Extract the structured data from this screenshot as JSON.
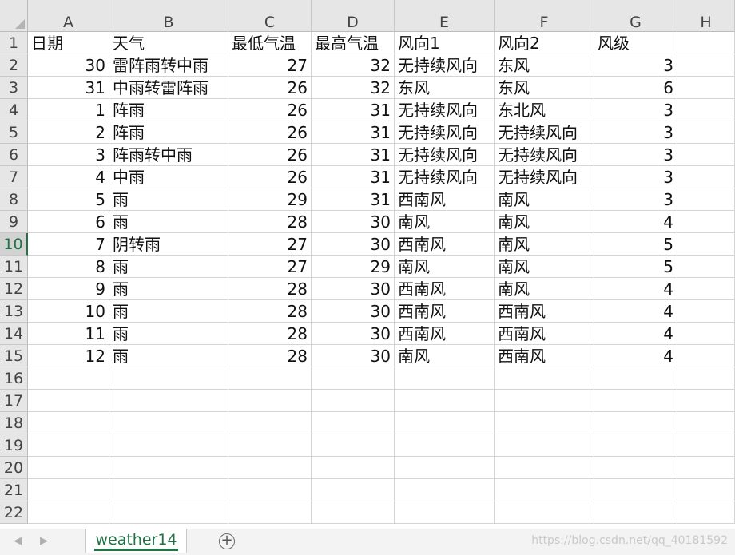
{
  "columns": [
    "A",
    "B",
    "C",
    "D",
    "E",
    "F",
    "G",
    "H"
  ],
  "row_numbers": [
    "1",
    "2",
    "3",
    "4",
    "5",
    "6",
    "7",
    "8",
    "9",
    "10",
    "11",
    "12",
    "13",
    "14",
    "15",
    "16",
    "17",
    "18",
    "19",
    "20",
    "21",
    "22"
  ],
  "active_row": "10",
  "header_row": [
    "日期",
    "天气",
    "最低气温",
    "最高气温",
    "风向1",
    "风向2",
    "风级"
  ],
  "rows": [
    [
      "30",
      "雷阵雨转中雨",
      "27",
      "32",
      "无持续风向",
      "东风",
      "3"
    ],
    [
      "31",
      "中雨转雷阵雨",
      "26",
      "32",
      "东风",
      "东风",
      "6"
    ],
    [
      "1",
      "阵雨",
      "26",
      "31",
      "无持续风向",
      "东北风",
      "3"
    ],
    [
      "2",
      "阵雨",
      "26",
      "31",
      "无持续风向",
      "无持续风向",
      "3"
    ],
    [
      "3",
      "阵雨转中雨",
      "26",
      "31",
      "无持续风向",
      "无持续风向",
      "3"
    ],
    [
      "4",
      "中雨",
      "26",
      "31",
      "无持续风向",
      "无持续风向",
      "3"
    ],
    [
      "5",
      "雨",
      "29",
      "31",
      "西南风",
      "南风",
      "3"
    ],
    [
      "6",
      "雨",
      "28",
      "30",
      "南风",
      "南风",
      "4"
    ],
    [
      "7",
      "阴转雨",
      "27",
      "30",
      "西南风",
      "南风",
      "5"
    ],
    [
      "8",
      "雨",
      "27",
      "29",
      "南风",
      "南风",
      "5"
    ],
    [
      "9",
      "雨",
      "28",
      "30",
      "西南风",
      "南风",
      "4"
    ],
    [
      "10",
      "雨",
      "28",
      "30",
      "西南风",
      "西南风",
      "4"
    ],
    [
      "11",
      "雨",
      "28",
      "30",
      "西南风",
      "西南风",
      "4"
    ],
    [
      "12",
      "雨",
      "28",
      "30",
      "南风",
      "西南风",
      "4"
    ]
  ],
  "sheet_tab": "weather14",
  "add_sheet_glyph": "+",
  "watermark": "https://blog.csdn.net/qq_40181592",
  "colors": {
    "accent": "#217346",
    "header_bg": "#e6e6e6",
    "grid": "#d4d4d4"
  }
}
